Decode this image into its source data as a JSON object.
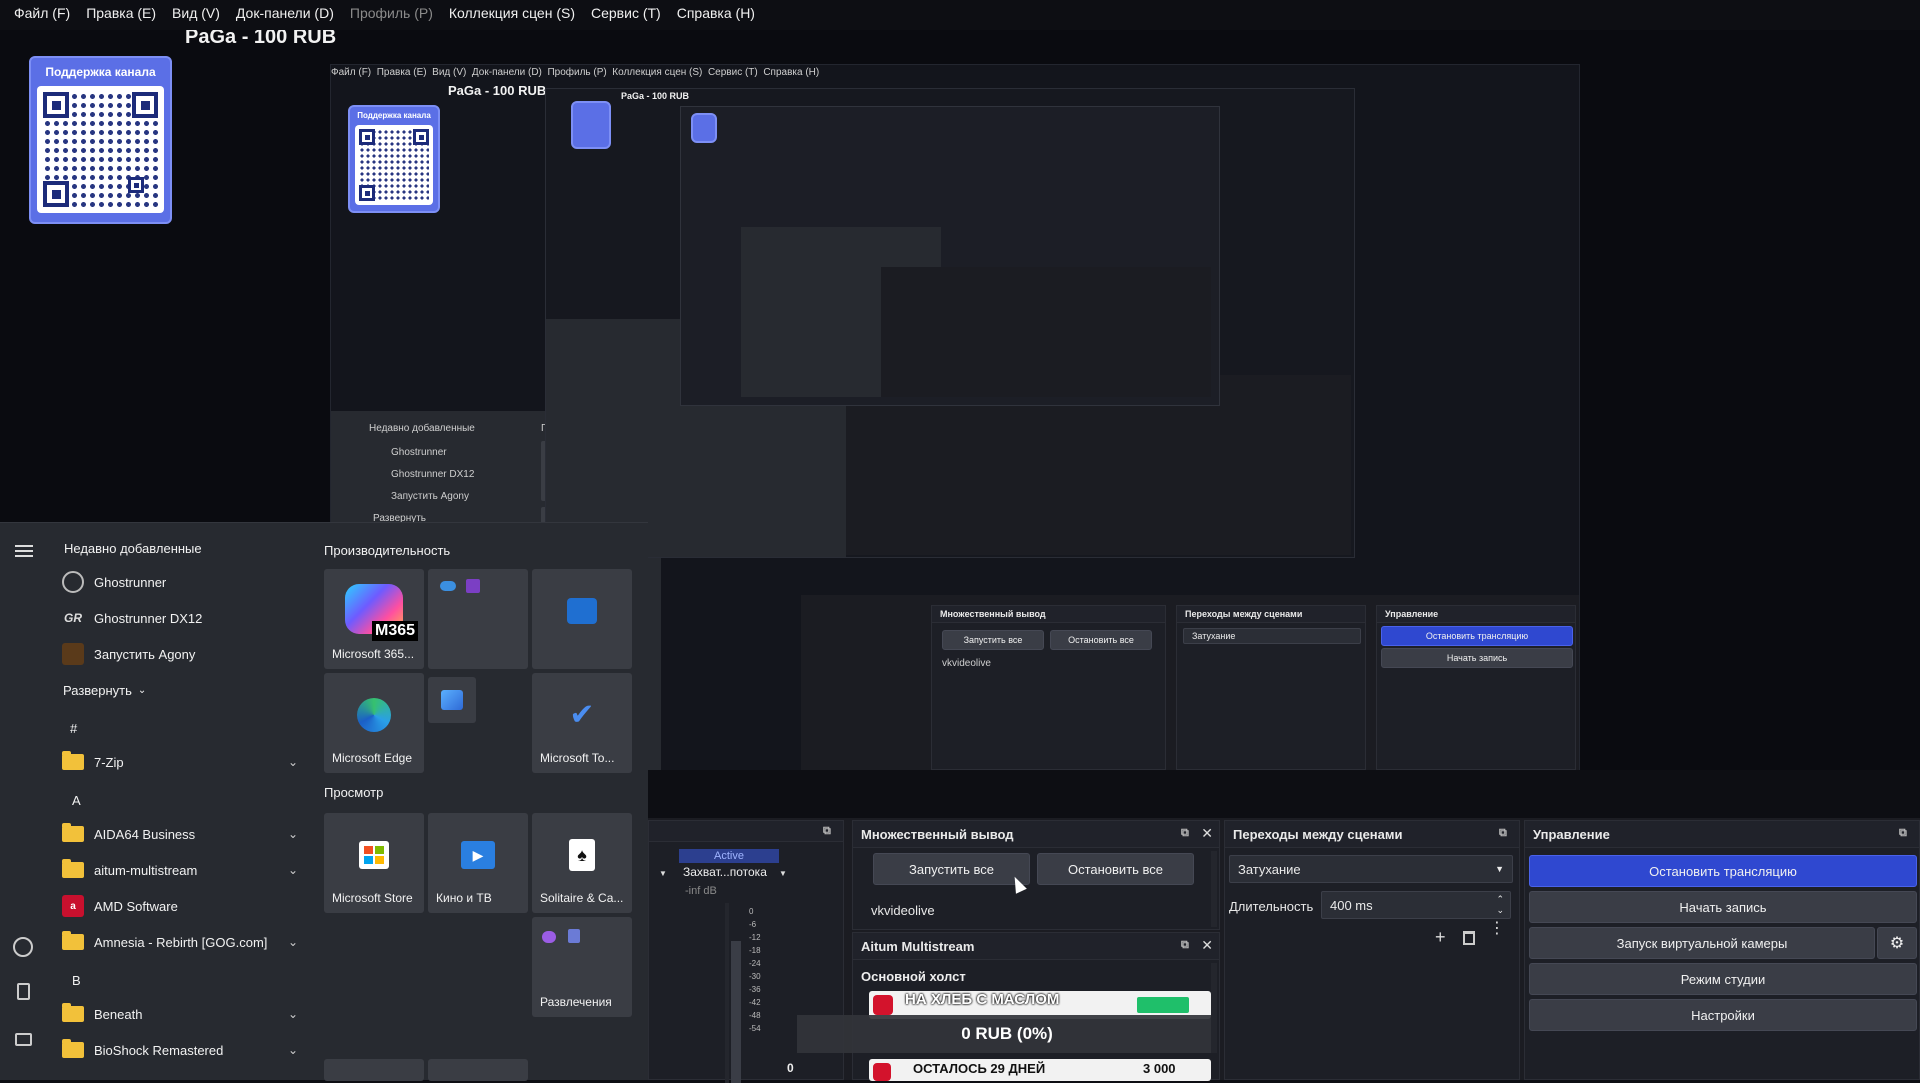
{
  "menu": [
    "Файл (F)",
    "Правка (E)",
    "Вид (V)",
    "Док-панели (D)",
    "Профиль (P)",
    "Коллекция сцен (S)",
    "Сервис (T)",
    "Справка (H)"
  ],
  "overlay": {
    "title": "PaGa - 100 RUB",
    "support_label": "Поддержка канала"
  },
  "start_menu": {
    "recent_header": "Недавно добавленные",
    "recent": [
      "Ghostrunner",
      "Ghostrunner DX12",
      "Запустить Agony"
    ],
    "expand": "Развернуть",
    "letters": [
      "#",
      "A",
      "B"
    ],
    "apps_hash": [
      "7-Zip"
    ],
    "apps_a": [
      "AIDA64 Business",
      "aitum-multistream",
      "AMD Software",
      "Amnesia - Rebirth [GOG.com]"
    ],
    "apps_b": [
      "Beneath",
      "BioShock Remastered"
    ],
    "group_productivity": "Производительность",
    "group_view": "Просмотр",
    "tiles": {
      "m365": "Microsoft 365...",
      "m365_badge": "M365",
      "edge": "Microsoft Edge",
      "todo": "Microsoft To...",
      "store": "Microsoft Store",
      "movies": "Кино и ТВ",
      "solitaire": "Solitaire & Ca...",
      "entertainment": "Развлечения"
    }
  },
  "mixer": {
    "active": "Active",
    "source": "Захват...потока",
    "inf": "-inf dB",
    "ticks": [
      "0",
      "-6",
      "-12",
      "-18",
      "-24",
      "-30",
      "-36",
      "-42",
      "-48",
      "-54"
    ],
    "zero": "0"
  },
  "multi_output": {
    "title": "Множественный вывод",
    "start_all": "Запустить все",
    "stop_all": "Остановить все",
    "target": "vkvideolive"
  },
  "aitum": {
    "title": "Aitum Multistream",
    "canvas": "Основной холст",
    "goal": "НА ХЛЕБ С МАСЛОМ",
    "progress": "0 RUB (0%)",
    "days": "ОСТАЛОСЬ 29 ДНЕЙ",
    "amount": "3 000"
  },
  "transitions": {
    "title": "Переходы между сценами",
    "selected": "Затухание",
    "duration_label": "Длительность",
    "duration_value": "400 ms"
  },
  "controls": {
    "title": "Управление",
    "stop_stream": "Остановить трансляцию",
    "start_record": "Начать запись",
    "virtual_cam": "Запуск виртуальной камеры",
    "studio_mode": "Режим студии",
    "settings": "Настройки"
  },
  "colors": {
    "accent": "#2f48d0",
    "support_card": "#5b6fe6",
    "folder": "#f2c13a"
  }
}
